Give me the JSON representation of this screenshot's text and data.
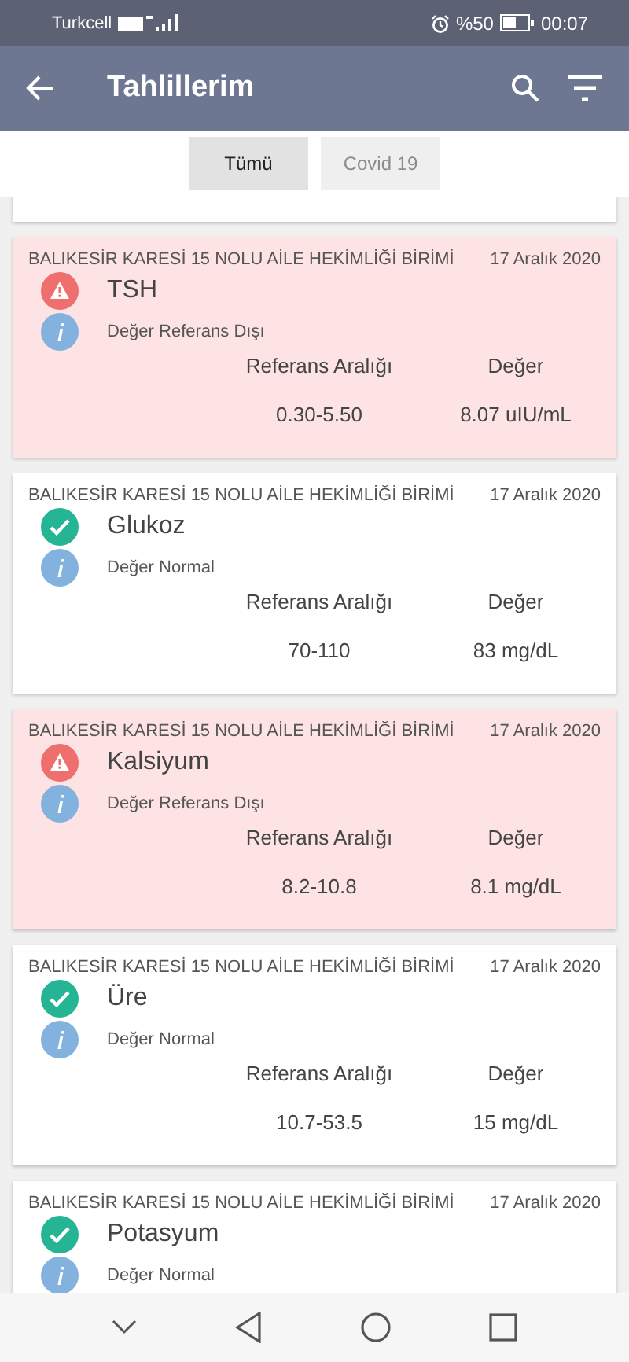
{
  "status_bar": {
    "carrier": "Turkcell",
    "battery": "%50",
    "time": "00:07"
  },
  "app_bar": {
    "title": "Tahlillerim"
  },
  "tabs": [
    {
      "label": "Tümü",
      "selected": true
    },
    {
      "label": "Covid 19",
      "selected": false
    }
  ],
  "results": [
    {
      "facility": "BALIKESİR KARESİ 15 NOLU AİLE HEKİMLİĞİ BİRİMİ",
      "date": "17 Aralık 2020",
      "kind": "abnormal",
      "name": "TSH",
      "status": "Değer Referans Dışı",
      "range_label": "Referans Aralığı",
      "value_label": "Değer",
      "range": "0.30-5.50",
      "value": "8.07 uIU/mL"
    },
    {
      "facility": "BALIKESİR KARESİ 15 NOLU AİLE HEKİMLİĞİ BİRİMİ",
      "date": "17 Aralık 2020",
      "kind": "normal",
      "name": "Glukoz",
      "status": "Değer Normal",
      "range_label": "Referans Aralığı",
      "value_label": "Değer",
      "range": "70-110",
      "value": "83 mg/dL"
    },
    {
      "facility": "BALIKESİR KARESİ 15 NOLU AİLE HEKİMLİĞİ BİRİMİ",
      "date": "17 Aralık 2020",
      "kind": "abnormal",
      "name": "Kalsiyum",
      "status": "Değer Referans Dışı",
      "range_label": "Referans Aralığı",
      "value_label": "Değer",
      "range": "8.2-10.8",
      "value": "8.1 mg/dL"
    },
    {
      "facility": "BALIKESİR KARESİ 15 NOLU AİLE HEKİMLİĞİ BİRİMİ",
      "date": "17 Aralık 2020",
      "kind": "normal",
      "name": "Üre",
      "status": "Değer Normal",
      "range_label": "Referans Aralığı",
      "value_label": "Değer",
      "range": "10.7-53.5",
      "value": "15 mg/dL"
    },
    {
      "facility": "BALIKESİR KARESİ 15 NOLU AİLE HEKİMLİĞİ BİRİMİ",
      "date": "17 Aralık 2020",
      "kind": "normal",
      "name": "Potasyum",
      "status": "Değer Normal"
    }
  ]
}
